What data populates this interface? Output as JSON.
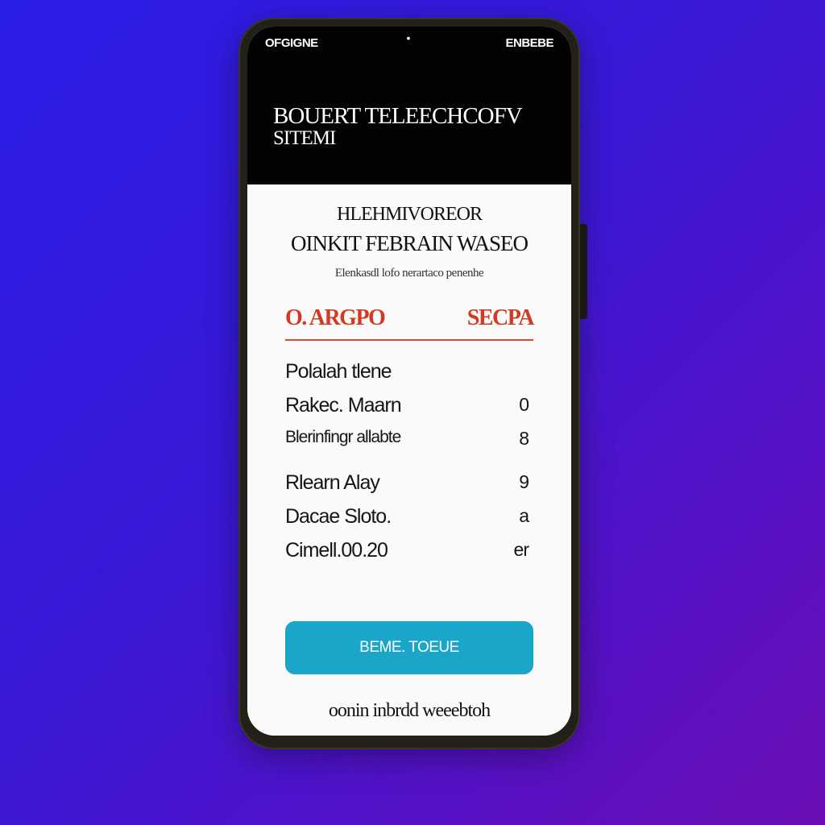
{
  "status_bar": {
    "left": "OFGIGNE",
    "right": "ENBEBE",
    "camera": "•"
  },
  "header": {
    "title": "BOUERT TELEECHCOFV",
    "subtitle": "SITEMI"
  },
  "card": {
    "heading": "HLEHMIVOREOR",
    "title": "OINKIT FEBRAIN WASEO",
    "description": "Elenkasdl lofo nerartaco penenhe"
  },
  "tabs": [
    {
      "label": "O. ARGPO"
    },
    {
      "label": "SECPA"
    }
  ],
  "rows": [
    {
      "label": "Polalah tlene",
      "value": ""
    },
    {
      "label": "Rakec. Maarn",
      "value": "0"
    },
    {
      "label": "Blerinfingr allabte",
      "value": "8"
    },
    {
      "label": "Rlearn Alay",
      "value": "9"
    },
    {
      "label": "Dacae Sloto.",
      "value": "a"
    },
    {
      "label": "Cimell.00.20",
      "value": "er"
    }
  ],
  "cta": {
    "label": "BEME. TOEUE"
  },
  "footer": {
    "link": "oonin inbrdd weeebtoh"
  },
  "colors": {
    "background": "#3a18d6",
    "accent_red": "#d23a22",
    "button": "#1aa6c8",
    "header_bg": "#030303"
  }
}
